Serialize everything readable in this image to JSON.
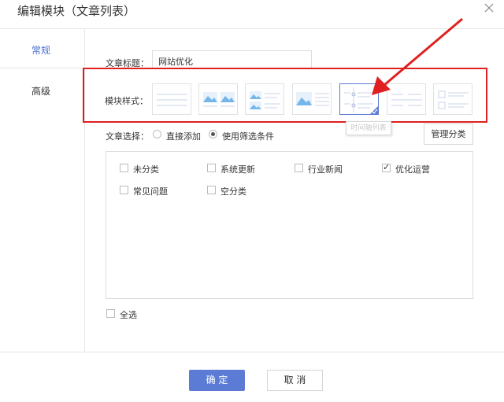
{
  "dialog": {
    "title": "编辑模块（文章列表）"
  },
  "sidebar": {
    "items": [
      {
        "label": "常规",
        "active": true
      },
      {
        "label": "高级",
        "active": false
      }
    ]
  },
  "form": {
    "article_title_label": "文章标题：",
    "article_title_value": "网站优化",
    "module_style_label": "模块样式：",
    "selected_style_tooltip": "时间轴列表",
    "article_select_label": "文章选择：",
    "radio_direct": "直接添加",
    "radio_filter": "使用筛选条件",
    "manage_categories": "管理分类",
    "categories": [
      {
        "label": "未分类",
        "checked": false
      },
      {
        "label": "系统更新",
        "checked": false
      },
      {
        "label": "行业新闻",
        "checked": false
      },
      {
        "label": "优化运营",
        "checked": true
      },
      {
        "label": "常见问题",
        "checked": false
      },
      {
        "label": "空分类",
        "checked": false
      }
    ],
    "select_all": "全选"
  },
  "footer": {
    "ok": "确 定",
    "cancel": "取 消"
  },
  "colors": {
    "accent": "#5b7bd5",
    "highlight": "#e02020",
    "active_text": "#4a6fd0"
  }
}
